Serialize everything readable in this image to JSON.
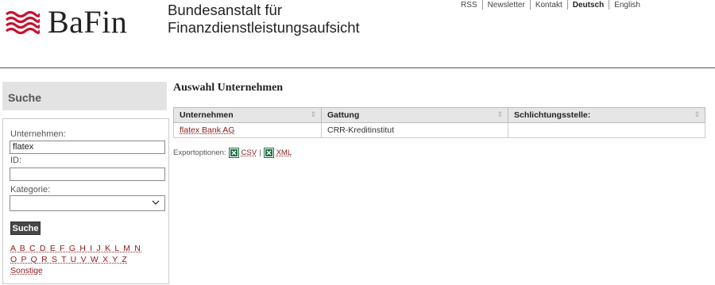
{
  "header": {
    "logo_text": "BaFin",
    "subtitle_line1": "Bundesanstalt für",
    "subtitle_line2": "Finanzdienstleistungsaufsicht",
    "meta_nav": [
      "RSS",
      "Newsletter",
      "Kontakt",
      "Deutsch",
      "English"
    ]
  },
  "sidebar": {
    "title": "Suche",
    "company_label": "Unternehmen:",
    "company_value": "flatex",
    "id_label": "ID:",
    "id_value": "",
    "category_label": "Kategorie:",
    "category_value": "",
    "search_button": "Suche",
    "alphabet_row1": "A B C D E F G H I J K L M N",
    "alphabet_row2": "O P Q R S T U V W X Y Z",
    "other_link": "Sonstige"
  },
  "main": {
    "title": "Auswahl Unternehmen",
    "columns": [
      "Unternehmen",
      "Gattung",
      "Schlichtungsstelle:"
    ],
    "rows": [
      [
        "flatex Bank AG",
        "CRR-Kreditinstitut",
        ""
      ]
    ],
    "export_label": "Exportoptionen:",
    "export_csv": "CSV",
    "export_sep": "|",
    "export_xml": "XML"
  },
  "colors": {
    "logo_red": "#c8102e",
    "link": "#8b1a1a",
    "button": "#474747",
    "header_gray": "#e3e3e3",
    "excel_green": "#1d6f42"
  },
  "icons": [
    "bafin-wave-logo-icon",
    "csv-export-icon",
    "xml-export-icon",
    "sort-icon",
    "chevron-down-icon"
  ]
}
